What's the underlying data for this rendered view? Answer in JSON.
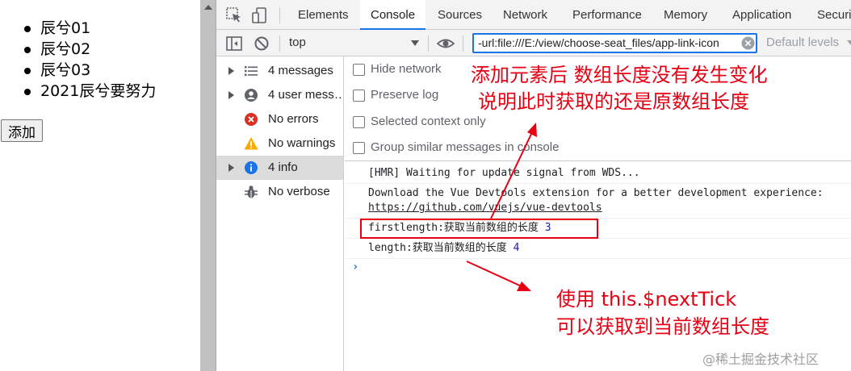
{
  "page": {
    "list_items": [
      "辰兮01",
      "辰兮02",
      "辰兮03",
      "2021辰兮要努力"
    ],
    "add_button": "添加"
  },
  "devtools": {
    "tabs": [
      "Elements",
      "Console",
      "Sources",
      "Network",
      "Performance",
      "Memory",
      "Application",
      "Securit"
    ],
    "active_tab": "Console",
    "context": "top",
    "filter_value": "-url:file:///E:/view/choose-seat_files/app-link-icon",
    "levels": "Default levels",
    "sidebar": [
      {
        "label": "4 messages",
        "icon": "list-icon"
      },
      {
        "label": "4 user mess…",
        "icon": "user-icon"
      },
      {
        "label": "No errors",
        "icon": "error-icon"
      },
      {
        "label": "No warnings",
        "icon": "warning-icon"
      },
      {
        "label": "4 info",
        "icon": "info-icon"
      },
      {
        "label": "No verbose",
        "icon": "bug-icon"
      }
    ],
    "settings": [
      "Hide network",
      "Preserve log",
      "Selected context only",
      "Group similar messages in console"
    ],
    "messages": {
      "hmr": "[HMR] Waiting for update signal from WDS...",
      "vue_line1": "Download the Vue Devtools extension for a better development experience:",
      "vue_link": "https://github.com/vuejs/vue-devtools",
      "first_text": "firstlength:获取当前数组的长度",
      "first_value": "3",
      "second_text": "length:获取当前数组的长度",
      "second_value": "4"
    }
  },
  "annotations": {
    "top_line1": "添加元素后 数组长度没有发生变化",
    "top_line2": "说明此时获取的还是原数组长度",
    "bottom_line1": "使用 this.$nextTick",
    "bottom_line2": "可以获取到当前数组长度",
    "color": "#e60012"
  },
  "watermark": "@稀土掘金技术社区"
}
